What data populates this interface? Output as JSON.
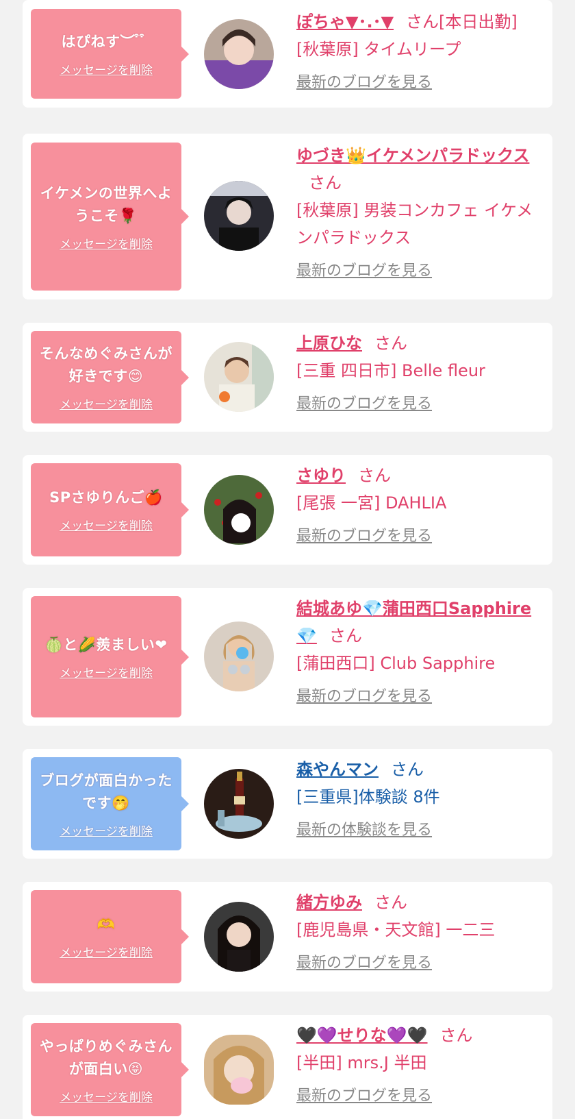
{
  "delete_label": "メッセージを削除",
  "cards": [
    {
      "message": "はぴねす︶ ͒ ͒ ︎",
      "name": "ぽちゃ▼･.･▼",
      "honorific": "さん[本日出勤]",
      "shop": "[秋葉原] タイムリープ",
      "link": "最新のブログを見る"
    },
    {
      "message": "イケメンの世界へようこそ🌹",
      "name": "ゆづき👑イケメンパラドックス",
      "honorific": "さん",
      "shop": "[秋葉原] 男装コンカフェ イケメンパラドックス",
      "link": "最新のブログを見る"
    },
    {
      "message": "そんなめぐみさんが好きです😊",
      "name": "上原ひな",
      "honorific": "さん",
      "shop": "[三重 四日市] Belle fleur",
      "link": "最新のブログを見る"
    },
    {
      "message": "SPさゆりんご🍎",
      "name": "さゆり",
      "honorific": "さん",
      "shop": "[尾張 一宮] DAHLIA",
      "link": "最新のブログを見る"
    },
    {
      "message": "🍈と🌽羨ましい❤",
      "name": "結城あゆ💎蒲田西口Sapphire💎",
      "honorific": "さん",
      "shop": "[蒲田西口] Club Sapphire",
      "link": "最新のブログを見る"
    },
    {
      "message": "ブログが面白かったです🤭",
      "name": "森やんマン",
      "honorific": "さん",
      "shop": "[三重県]体験談 8件",
      "link": "最新の体験談を見る"
    },
    {
      "message": "🫶",
      "name": "緒方ゆみ",
      "honorific": "さん",
      "shop": "[鹿児島県・天文館] 一二三",
      "link": "最新のブログを見る"
    },
    {
      "message": "やっぱりめぐみさんが面白い😝",
      "name": "🖤💜せりな💜🖤",
      "honorific": "さん",
      "shop": "[半田] mrs.J 半田",
      "link": "最新のブログを見る"
    }
  ],
  "colors": {
    "accent_pink": "#e0406a",
    "bubble_pink": "#f7909c",
    "bubble_blue": "#8db9f2",
    "accent_blue": "#1a5fa8",
    "link_gray": "#888888"
  }
}
